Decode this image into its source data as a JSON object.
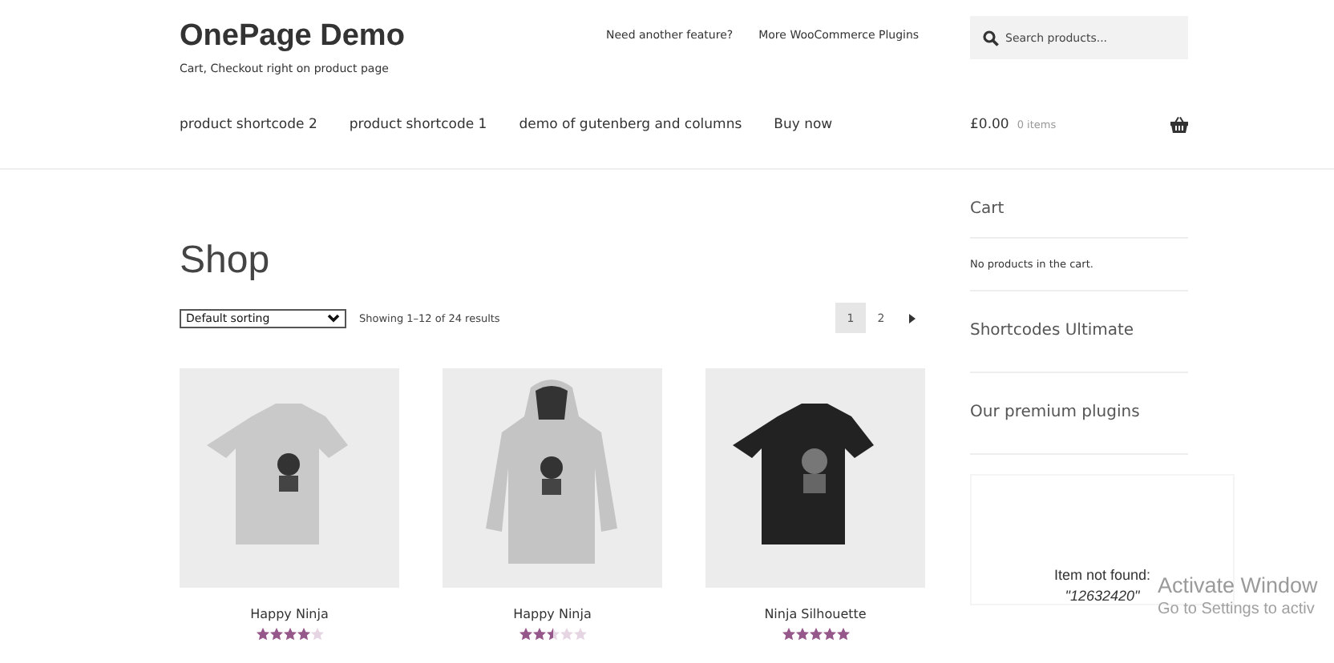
{
  "site": {
    "title": "OnePage Demo",
    "tagline": "Cart, Checkout right on product page"
  },
  "top_links": [
    "Need another feature?",
    "More WooCommerce Plugins"
  ],
  "search": {
    "placeholder": "Search products..."
  },
  "nav": [
    "product shortcode 2",
    "product shortcode 1",
    "demo of gutenberg and columns",
    "Buy now"
  ],
  "header_cart": {
    "total": "£0.00",
    "count": "0 items"
  },
  "page_title": "Shop",
  "sorting": {
    "value": "Default sorting"
  },
  "result_count": "Showing 1–12 of 24 results",
  "pagination": [
    {
      "label": "1",
      "selected": true,
      "kind": "page"
    },
    {
      "label": "2",
      "selected": false,
      "kind": "page"
    },
    {
      "kind": "next",
      "selected": false
    }
  ],
  "products": [
    {
      "name": "Happy Ninja",
      "kind": "tshirt",
      "stars": 4
    },
    {
      "name": "Happy Ninja",
      "kind": "hoodie",
      "stars": 2.5
    },
    {
      "name": "Ninja Silhouette",
      "kind": "dark-tshirt",
      "stars": 5
    }
  ],
  "sidebar": {
    "widgets": [
      {
        "title": "Cart",
        "text": "No products in the cart."
      },
      {
        "title": "Shortcodes Ultimate"
      },
      {
        "title": "Our premium plugins"
      }
    ],
    "embed": {
      "message": "Item not found:",
      "code": "\"12632420\""
    }
  },
  "os_overlay": {
    "title": "Activate Window",
    "subtitle": "Go to Settings to activ"
  }
}
